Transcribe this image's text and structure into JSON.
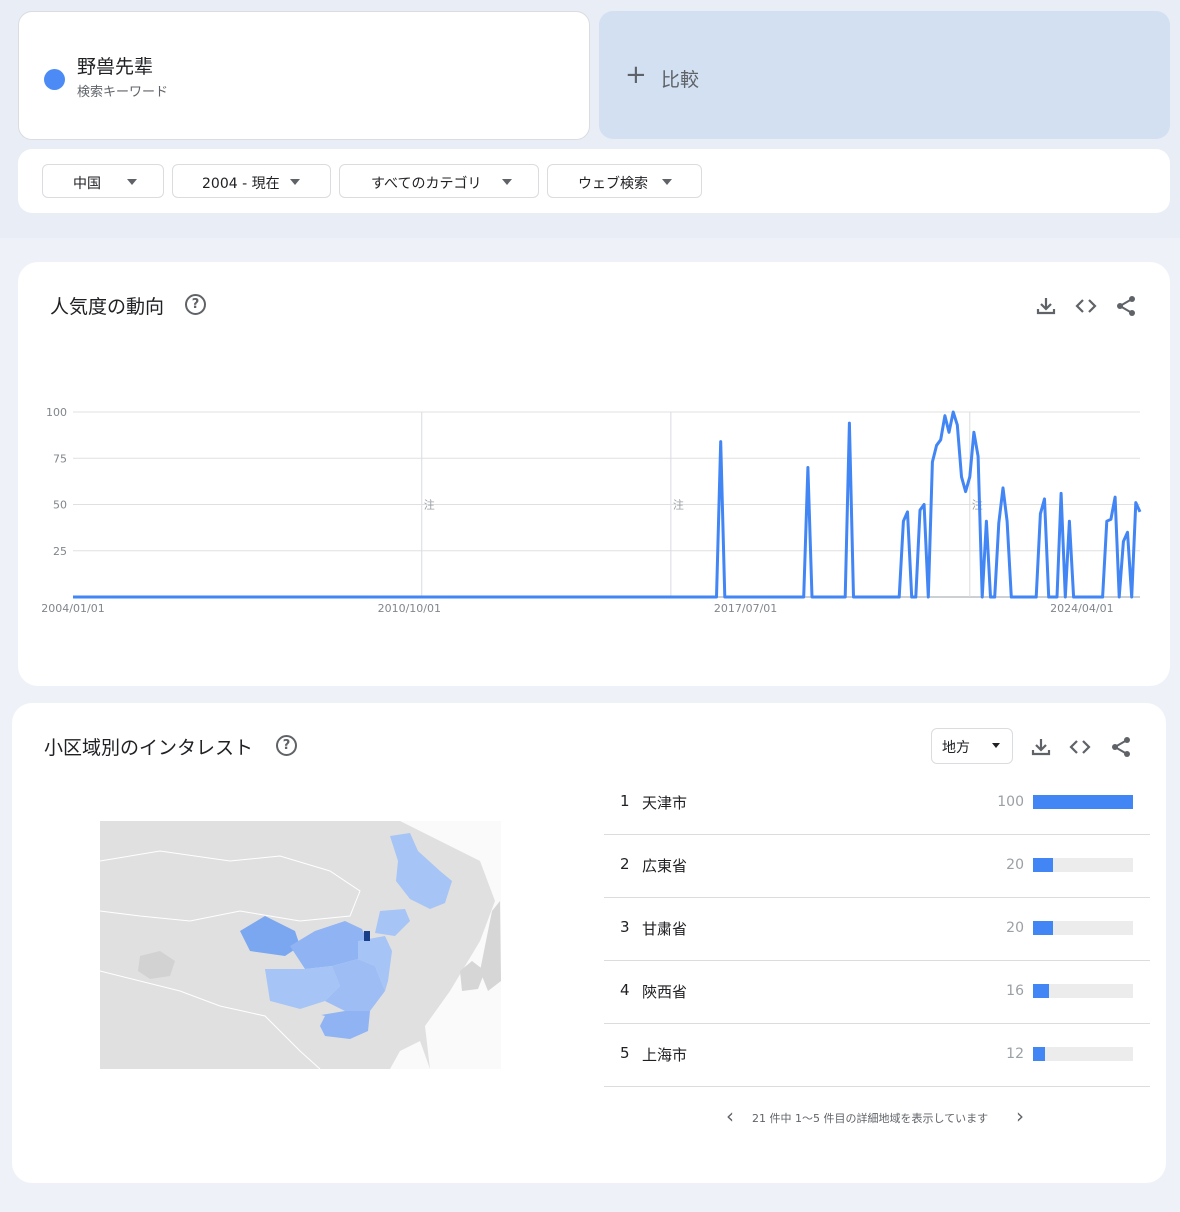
{
  "search_term": {
    "name": "野兽先辈",
    "type_label": "検索キーワード",
    "color": "#4c8bf5"
  },
  "compare": {
    "label": "比較",
    "plus_icon": "plus-icon"
  },
  "filters": {
    "region": "中国",
    "time": "2004 - 現在",
    "category": "すべてのカテゴリ",
    "search_type": "ウェブ検索"
  },
  "trend": {
    "title": "人気度の動向",
    "note_marker": "注",
    "chart_data": {
      "type": "line",
      "title": "",
      "xlabel": "",
      "ylabel": "",
      "ylim": [
        0,
        100
      ],
      "yticks": [
        25,
        50,
        75,
        100
      ],
      "x_tick_labels": [
        "2004/01/01",
        "2010/10/01",
        "2017/07/01",
        "2024/04/01"
      ],
      "x_range": [
        "2004-01",
        "2025-06"
      ],
      "grid": true,
      "legend": "none",
      "series": [
        {
          "color": "#4285f4",
          "points": [
            [
              "2004-01",
              0
            ],
            [
              "2016-12",
              0
            ],
            [
              "2017-01",
              84
            ],
            [
              "2017-02",
              0
            ],
            [
              "2018-09",
              0
            ],
            [
              "2018-10",
              70
            ],
            [
              "2018-11",
              0
            ],
            [
              "2019-07",
              0
            ],
            [
              "2019-08",
              94
            ],
            [
              "2019-09",
              0
            ],
            [
              "2020-08",
              0
            ],
            [
              "2020-09",
              41
            ],
            [
              "2020-10",
              46
            ],
            [
              "2020-11",
              0
            ],
            [
              "2020-12",
              0
            ],
            [
              "2021-01",
              47
            ],
            [
              "2021-02",
              50
            ],
            [
              "2021-03",
              0
            ],
            [
              "2021-04",
              73
            ],
            [
              "2021-05",
              82
            ],
            [
              "2021-06",
              85
            ],
            [
              "2021-07",
              98
            ],
            [
              "2021-08",
              89
            ],
            [
              "2021-09",
              100
            ],
            [
              "2021-10",
              93
            ],
            [
              "2021-11",
              65
            ],
            [
              "2021-12",
              57
            ],
            [
              "2022-01",
              65
            ],
            [
              "2022-02",
              89
            ],
            [
              "2022-03",
              76
            ],
            [
              "2022-04",
              0
            ],
            [
              "2022-05",
              41
            ],
            [
              "2022-06",
              0
            ],
            [
              "2022-07",
              0
            ],
            [
              "2022-08",
              40
            ],
            [
              "2022-09",
              59
            ],
            [
              "2022-10",
              41
            ],
            [
              "2022-11",
              0
            ],
            [
              "2023-05",
              0
            ],
            [
              "2023-06",
              45
            ],
            [
              "2023-07",
              53
            ],
            [
              "2023-08",
              0
            ],
            [
              "2023-10",
              0
            ],
            [
              "2023-11",
              56
            ],
            [
              "2023-12",
              0
            ],
            [
              "2024-01",
              41
            ],
            [
              "2024-02",
              0
            ],
            [
              "2024-09",
              0
            ],
            [
              "2024-10",
              41
            ],
            [
              "2024-11",
              42
            ],
            [
              "2024-12",
              54
            ],
            [
              "2025-01",
              0
            ],
            [
              "2025-01",
              0
            ],
            [
              "2025-02",
              30
            ],
            [
              "2025-03",
              35
            ],
            [
              "2025-04",
              0
            ],
            [
              "2025-05",
              51
            ],
            [
              "2025-06",
              46
            ]
          ]
        }
      ]
    }
  },
  "regions": {
    "title": "小区域別のインタレスト",
    "select_label": "地方",
    "items": [
      {
        "rank": "1",
        "name": "天津市",
        "value": 100
      },
      {
        "rank": "2",
        "name": "広東省",
        "value": 20
      },
      {
        "rank": "3",
        "name": "甘粛省",
        "value": 20
      },
      {
        "rank": "4",
        "name": "陝西省",
        "value": 16
      },
      {
        "rank": "5",
        "name": "上海市",
        "value": 12
      }
    ],
    "pager_text": "21 件中 1〜5 件目の詳細地域を表示しています"
  }
}
